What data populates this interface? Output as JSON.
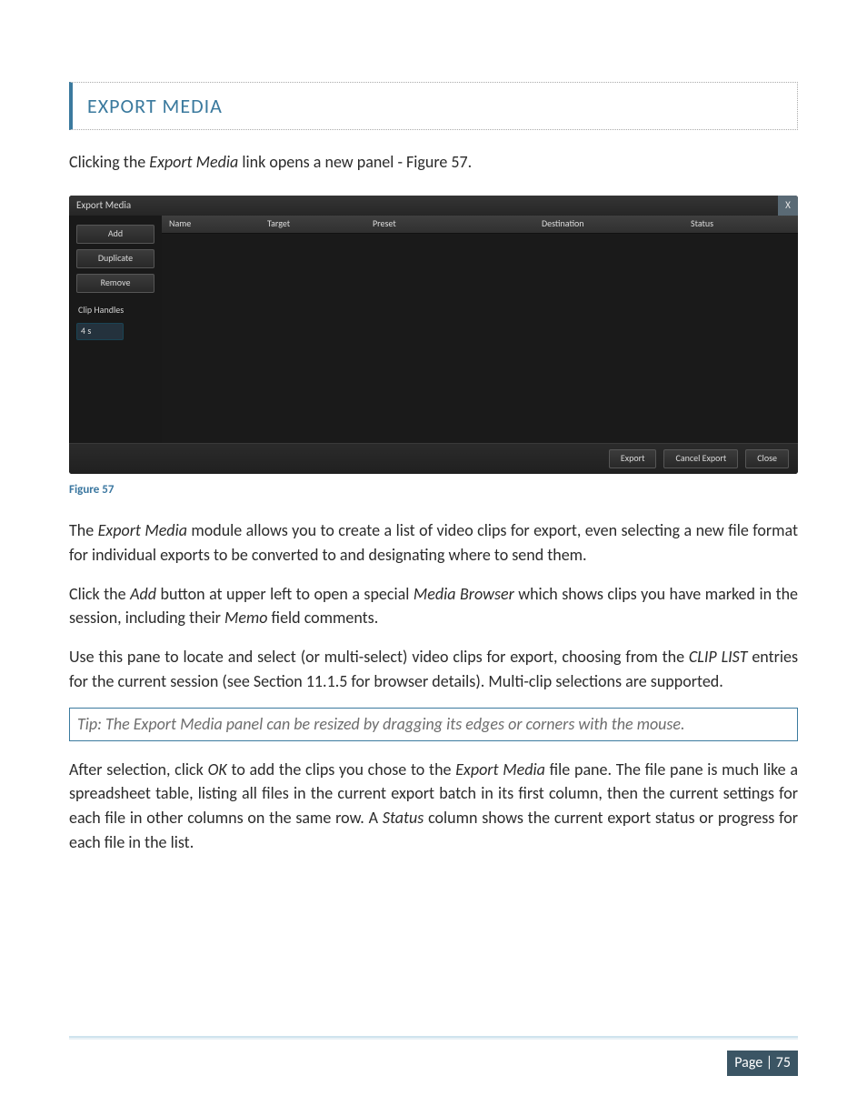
{
  "heading": "EXPORT MEDIA",
  "intro": {
    "pre": "Clicking the ",
    "em": "Export Media",
    "post": " link opens a new panel - Figure 57."
  },
  "panel": {
    "title": "Export Media",
    "close_glyph": "X",
    "sidebar": {
      "add": "Add",
      "duplicate": "Duplicate",
      "remove": "Remove",
      "clip_handles_label": "Clip Handles",
      "clip_handles_value": "4 s"
    },
    "columns": {
      "name": "Name",
      "target": "Target",
      "preset": "Preset",
      "destination": "Destination",
      "status": "Status"
    },
    "footer": {
      "export": "Export",
      "cancel_export": "Cancel Export",
      "close": "Close"
    }
  },
  "figure_caption": "Figure 57",
  "para1": {
    "a": "The ",
    "em1": "Export Media",
    "b": " module allows you to create a list of video clips for export, even selecting a new file format for individual exports to be converted to and designating where to send them."
  },
  "para2": {
    "a": "Click the ",
    "em1": "Add",
    "b": " button at upper left to open a special ",
    "em2": "Media Browser",
    "c": " which shows clips you have marked in the session, including their ",
    "em3": "Memo",
    "d": " field comments."
  },
  "para3": {
    "a": "Use this pane to locate and select (or multi-select) video clips for export, choosing from the ",
    "em1": "CLIP LIST",
    "b": " entries for the current session (see Section 11.1.5 for browser details).  Multi-clip selections are supported."
  },
  "tip": "Tip: The Export Media panel can be resized by dragging its edges or corners with the mouse.",
  "para4": {
    "a": "After selection, click ",
    "em1": "OK",
    "b": " to add the clips you chose to the ",
    "em2": "Export Media",
    "c": " file pane.  The file pane is much like a spreadsheet table, listing all files in the current export batch in its first column, then the current settings for each file in other columns on the same row.  A ",
    "em3": "Status",
    "d": " column shows the current export status or progress for each file in the list."
  },
  "page_number": "Page | 75"
}
